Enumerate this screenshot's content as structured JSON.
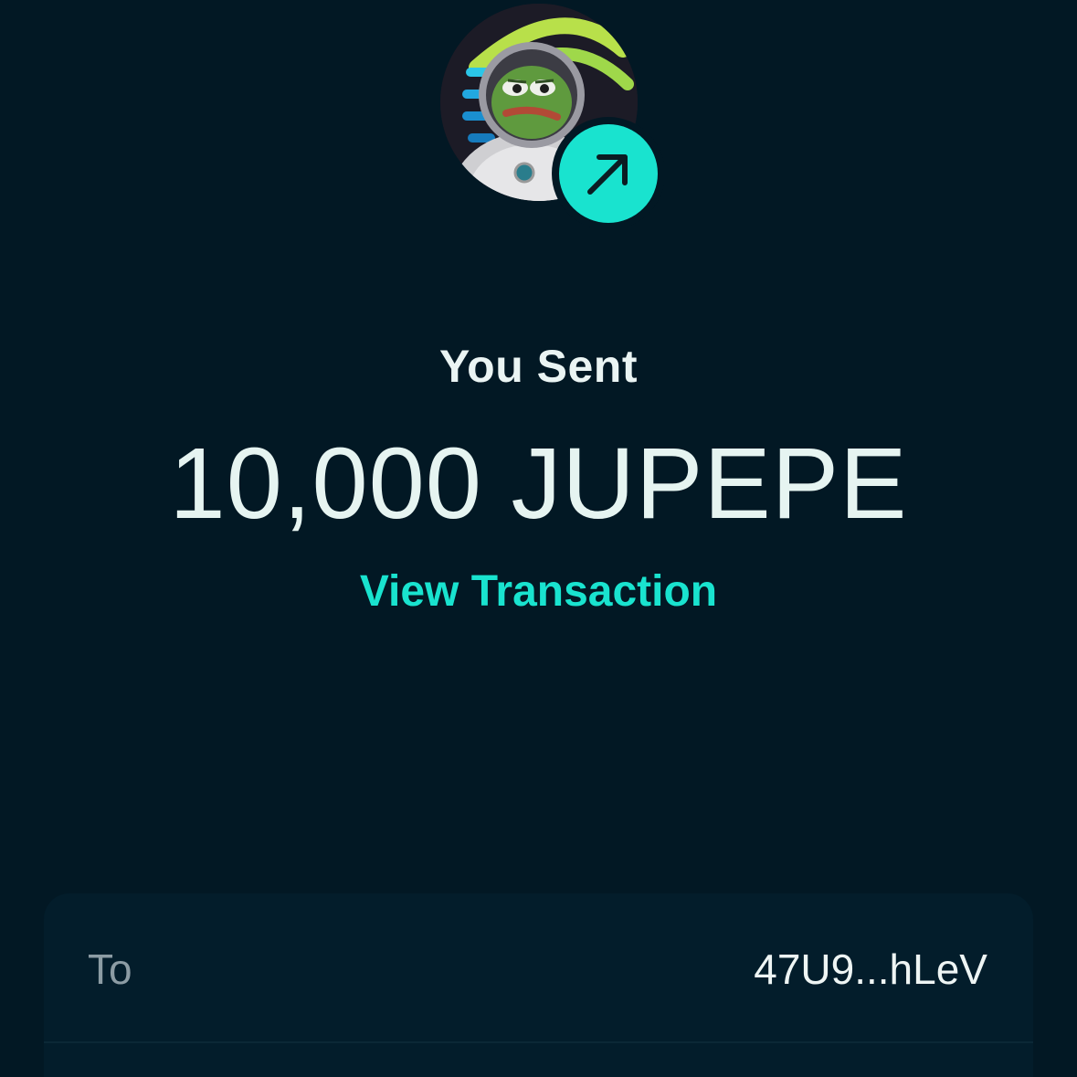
{
  "token": {
    "avatar_icon": "astronaut-pepe-token-icon",
    "badge_icon": "arrow-up-right-icon",
    "accent_color": "#19e3cf"
  },
  "header": {
    "title": "You Sent"
  },
  "transfer": {
    "amount": "10,000 JUPEPE",
    "view_transaction_label": "View Transaction"
  },
  "details": {
    "rows": [
      {
        "label": "To",
        "value": "47U9...hLeV"
      }
    ]
  }
}
